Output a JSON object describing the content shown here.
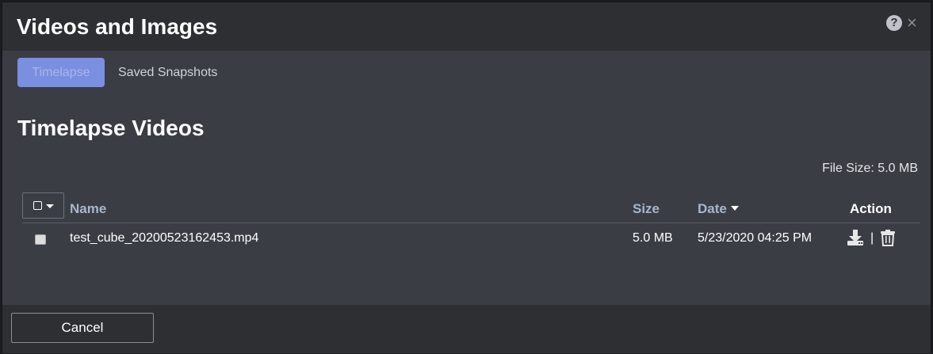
{
  "modal": {
    "title": "Videos and Images",
    "help_icon": "question-circle-icon",
    "help_glyph": "?",
    "close_icon": "close-icon",
    "close_glyph": "×"
  },
  "tabs": [
    {
      "label": "Timelapse",
      "active": true
    },
    {
      "label": "Saved Snapshots",
      "active": false
    }
  ],
  "section": {
    "title": "Timelapse Videos",
    "file_size": "File Size: 5.0 MB"
  },
  "table": {
    "columns": {
      "name": "Name",
      "size": "Size",
      "date": "Date",
      "action": "Action"
    },
    "sort_column": "date",
    "rows": [
      {
        "name": "test_cube_20200523162453.mp4",
        "size": "5.0 MB",
        "date": "5/23/2020 04:25 PM",
        "actions": [
          "download-icon",
          "trash-icon"
        ],
        "separator": "|"
      }
    ]
  },
  "footer": {
    "cancel_label": "Cancel"
  },
  "colors": {
    "accent_tab": "#7b8fe0",
    "header_bg": "#2e2f33",
    "body_bg": "#3a3d44",
    "column_header": "#a8b7c9"
  }
}
